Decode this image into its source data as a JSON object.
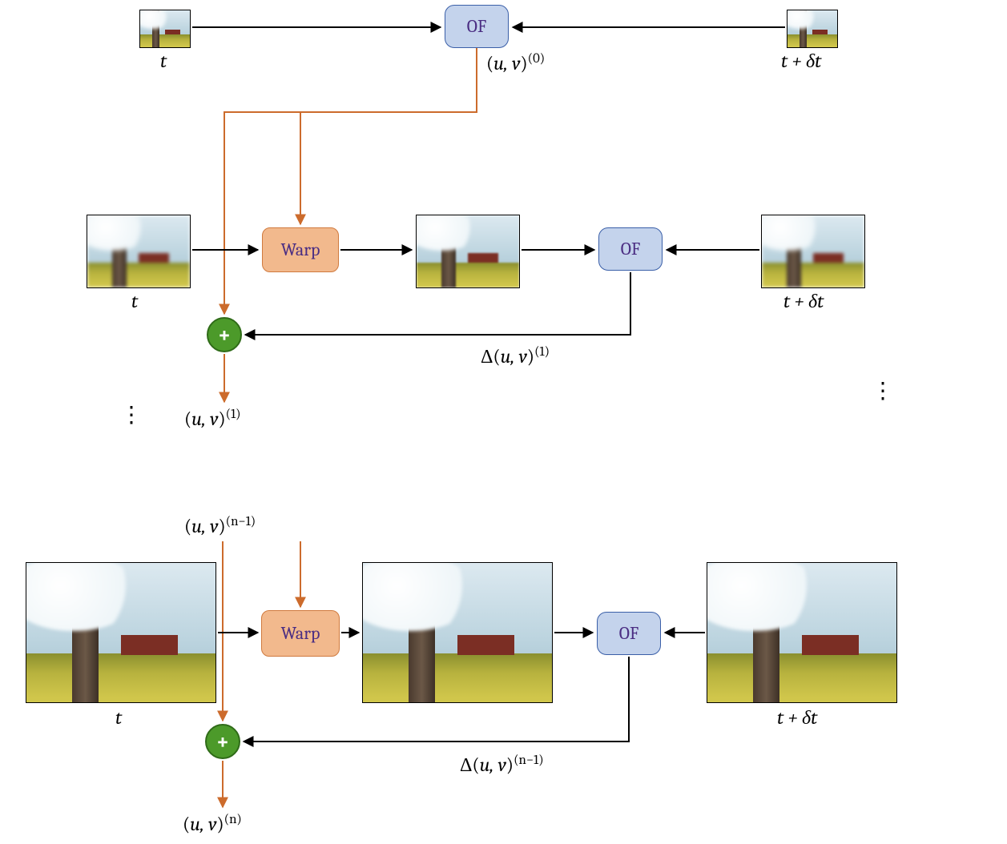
{
  "blocks": {
    "of": "OF",
    "warp": "Warp",
    "plus": "+"
  },
  "frameLabels": {
    "t": "t",
    "tdt": "t + δt"
  },
  "flow": {
    "uv0": "(u, v)",
    "uv0_sup": "(0)",
    "uv1": "(u, v)",
    "uv1_sup": "(1)",
    "duv1": "Δ(u, v)",
    "duv1_sup": "(1)",
    "uvnm1": "(u, v)",
    "uvnm1_sup": "(n−1)",
    "duvnm1": "Δ(u, v)",
    "duvnm1_sup": "(n−1)",
    "uvn": "(u, v)",
    "uvn_sup": "(n)"
  },
  "dots": "⋮",
  "colors": {
    "black": "#000000",
    "orange": "#cc6b2c"
  }
}
